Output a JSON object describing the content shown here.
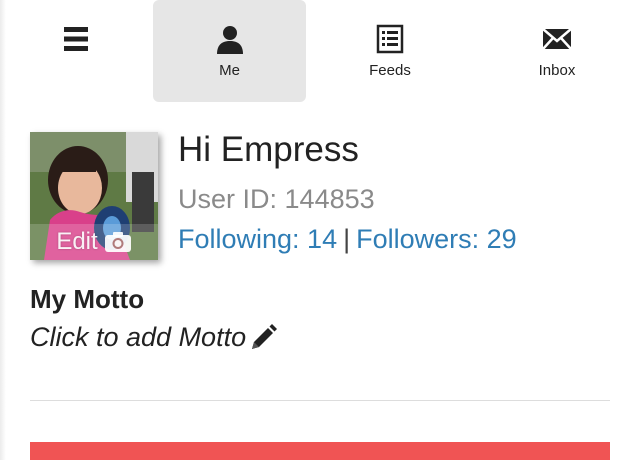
{
  "nav": {
    "menu": {
      "icon": "menu-icon"
    },
    "me": {
      "label": "Me",
      "icon": "person-icon",
      "active": true
    },
    "feeds": {
      "label": "Feeds",
      "icon": "list-icon"
    },
    "inbox": {
      "label": "Inbox",
      "icon": "envelope-icon"
    }
  },
  "profile": {
    "avatar_edit_label": "Edit",
    "greeting": "Hi Empress",
    "user_id_label": "User ID:",
    "user_id": "144853",
    "following": "Following: 14",
    "separator": "|",
    "followers": "Followers: 29"
  },
  "motto": {
    "title": "My Motto",
    "placeholder": "Click to add Motto"
  },
  "colors": {
    "link": "#2f7db5",
    "active_tab_bg": "#e6e6e6",
    "accent_bar": "#f05454",
    "muted_text": "#8a8a8a"
  }
}
